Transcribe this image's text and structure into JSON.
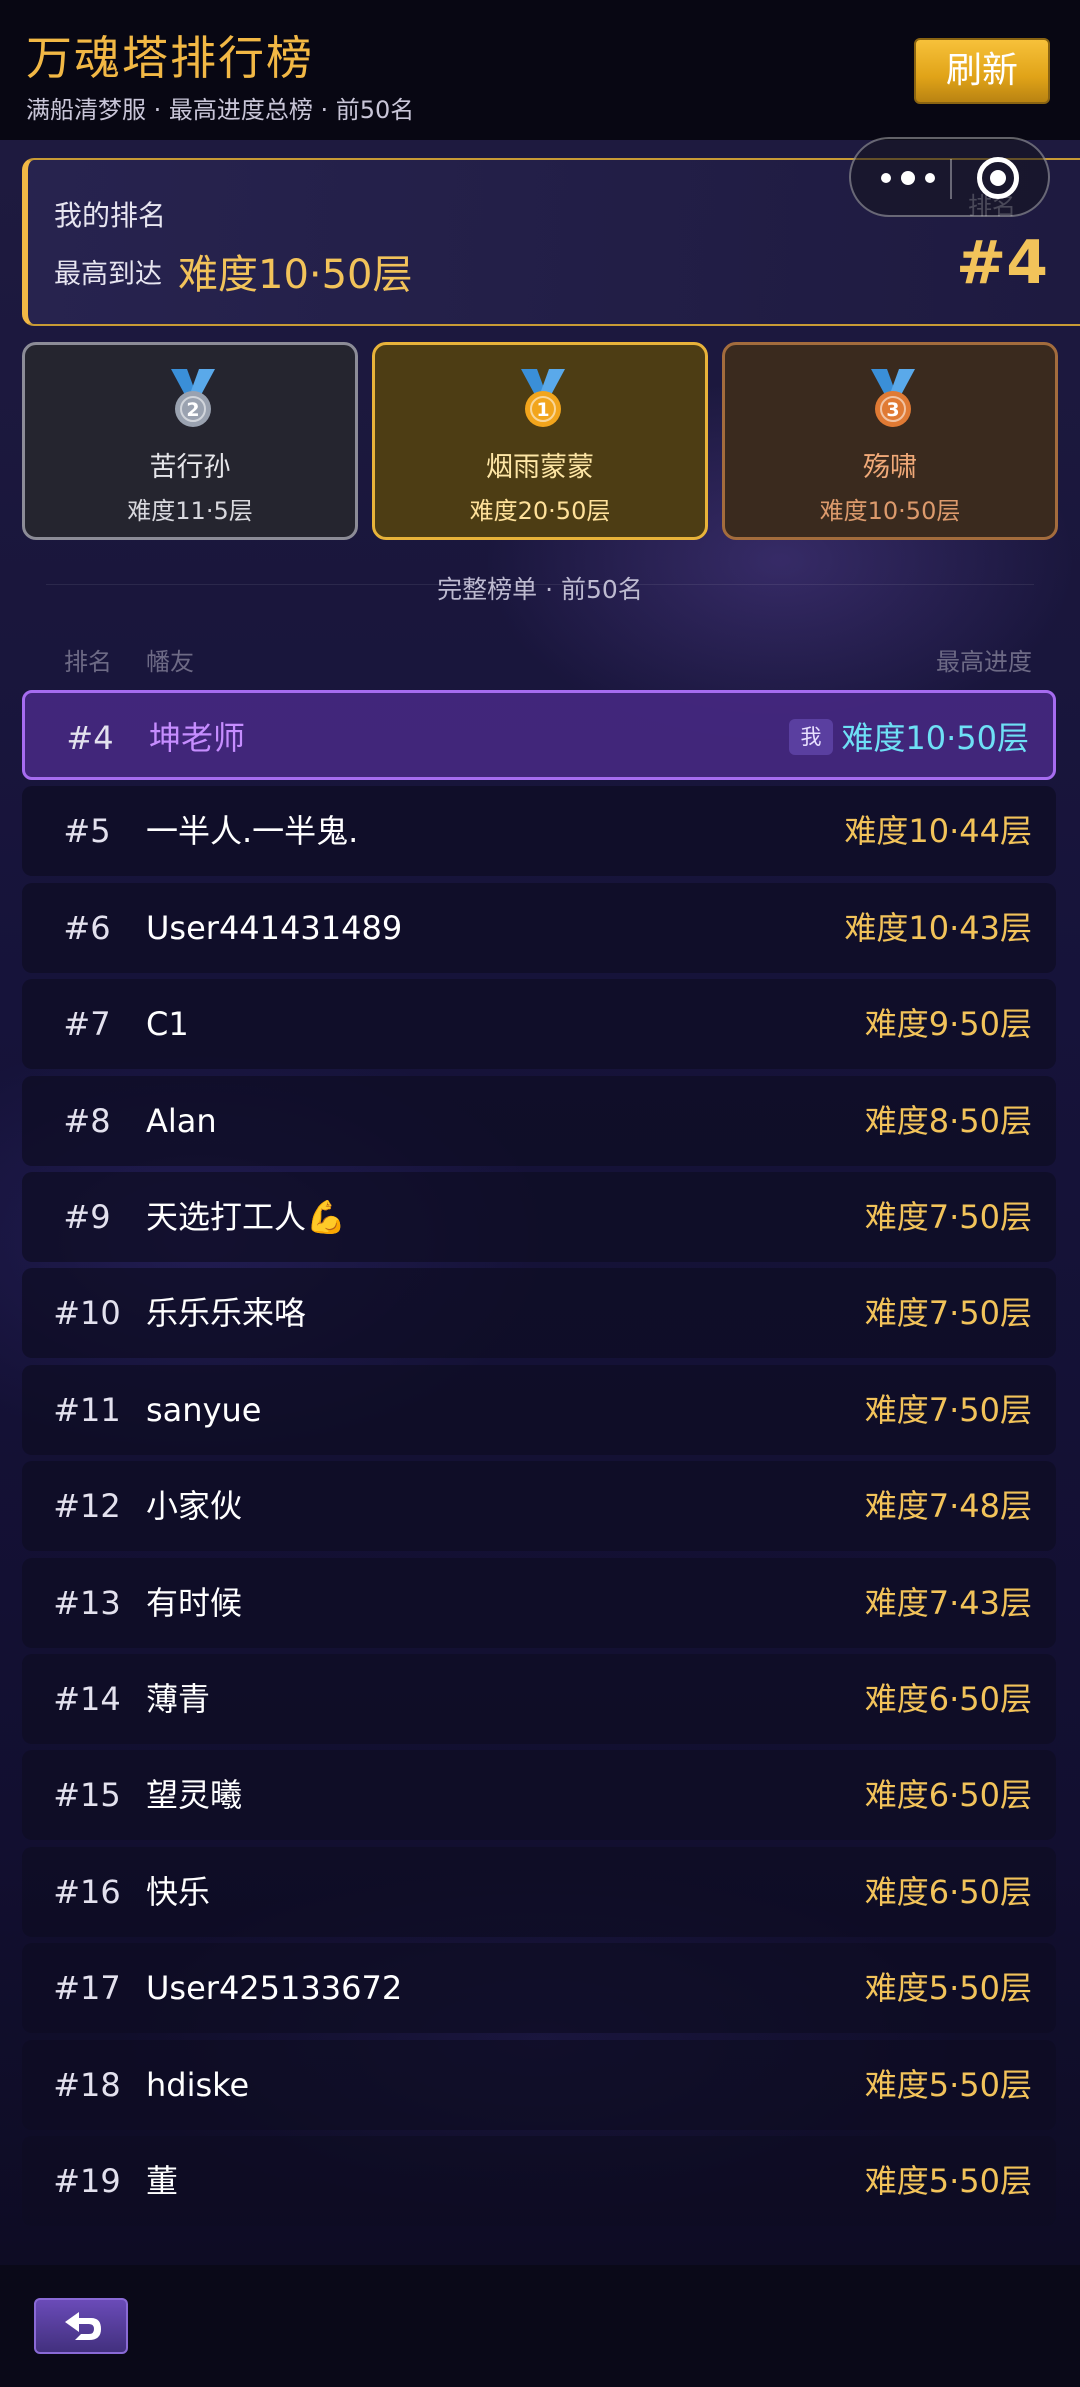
{
  "header": {
    "title": "万魂塔排行榜",
    "subtitle": "满船清梦服 · 最高进度总榜 · 前50名",
    "refresh_label": "刷新"
  },
  "my_rank": {
    "label": "我的排名",
    "reach_label": "最高到达",
    "reach_value": "难度10·50层",
    "rank_caption": "排名",
    "rank_value": "#4"
  },
  "podium": [
    {
      "place": "2",
      "name": "苦行孙",
      "score": "难度11·5层",
      "color": "#9aa2b0"
    },
    {
      "place": "1",
      "name": "烟雨蒙蒙",
      "score": "难度20·50层",
      "color": "#f2a51c"
    },
    {
      "place": "3",
      "name": "殇啸",
      "score": "难度10·50层",
      "color": "#e07a34"
    }
  ],
  "list": {
    "title": "完整榜单 · 前50名",
    "col_rank": "排名",
    "col_name": "幡友",
    "col_progress": "最高进度",
    "me_badge": "我",
    "rows": [
      {
        "rank": "#4",
        "name": "坤老师",
        "progress": "难度10·50层",
        "me": true
      },
      {
        "rank": "#5",
        "name": "一半人.一半鬼.",
        "progress": "难度10·44层"
      },
      {
        "rank": "#6",
        "name": "User441431489",
        "progress": "难度10·43层"
      },
      {
        "rank": "#7",
        "name": "C1",
        "progress": "难度9·50层"
      },
      {
        "rank": "#8",
        "name": "Alan",
        "progress": "难度8·50层"
      },
      {
        "rank": "#9",
        "name": "天选打工人💪",
        "progress": "难度7·50层"
      },
      {
        "rank": "#10",
        "name": "乐乐乐来咯",
        "progress": "难度7·50层"
      },
      {
        "rank": "#11",
        "name": "sanyue",
        "progress": "难度7·50层"
      },
      {
        "rank": "#12",
        "name": "小家伙",
        "progress": "难度7·48层"
      },
      {
        "rank": "#13",
        "name": "有时候",
        "progress": "难度7·43层"
      },
      {
        "rank": "#14",
        "name": "薄青",
        "progress": "难度6·50层"
      },
      {
        "rank": "#15",
        "name": "望灵曦",
        "progress": "难度6·50层"
      },
      {
        "rank": "#16",
        "name": "快乐",
        "progress": "难度6·50层"
      },
      {
        "rank": "#17",
        "name": "User425133672",
        "progress": "难度5·50层"
      },
      {
        "rank": "#18",
        "name": "hdiske",
        "progress": "难度5·50层"
      },
      {
        "rank": "#19",
        "name": "董",
        "progress": "难度5·50层"
      }
    ]
  },
  "icons": {
    "more": "more-dots-icon",
    "target": "target-icon",
    "back": "back-arrow-icon",
    "medal": "medal-icon"
  }
}
